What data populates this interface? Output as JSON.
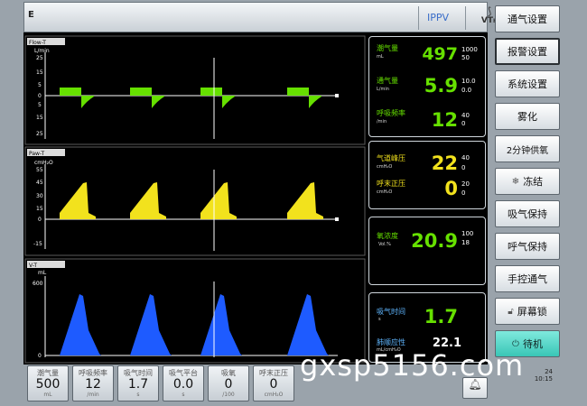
{
  "header": {
    "mode_letter": "E",
    "vent_mode": "IPPV",
    "trigger_label": "VT",
    "trigger_sub": "H"
  },
  "waves": {
    "flow": {
      "title": "Flow-T",
      "unit": "L/min",
      "ticks": [
        "25",
        "15",
        "5",
        "0",
        "5",
        "15",
        "25"
      ]
    },
    "paw": {
      "title": "Paw-T",
      "unit": "cmH₂O",
      "ticks": [
        "55",
        "45",
        "30",
        "15",
        "0",
        "-15"
      ]
    },
    "volume": {
      "title": "V-T",
      "unit": "mL",
      "ticks": [
        "600",
        "0"
      ]
    }
  },
  "values": {
    "tidal": {
      "label": "潮气量",
      "unit": "mL",
      "value": "497",
      "hi": "1000",
      "lo": "50"
    },
    "minute": {
      "label": "通气量",
      "unit": "L/min",
      "value": "5.9",
      "hi": "10.0",
      "lo": "0.0"
    },
    "rate": {
      "label": "呼吸频率",
      "unit": "/min",
      "value": "12",
      "hi": "40",
      "lo": "0"
    },
    "peak": {
      "label": "气道峰压",
      "unit": "cmH₂O",
      "value": "22",
      "hi": "40",
      "lo": "0"
    },
    "peep": {
      "label": "呼末正压",
      "unit": "cmH₂O",
      "value": "0",
      "hi": "20",
      "lo": "0"
    },
    "o2": {
      "label": "氧浓度",
      "unit": "Vol.%",
      "value": "20.9",
      "hi": "100",
      "lo": "18"
    },
    "insp_time": {
      "label": "吸气时间",
      "unit": "s",
      "value": "1.7"
    },
    "compliance": {
      "label": "肺顺应性",
      "unit": "mL/cmH₂O",
      "value": "22.1"
    }
  },
  "menu": {
    "vent_settings": "通气设置",
    "alarm_settings": "报警设置",
    "system_settings": "系统设置",
    "nebulize": "雾化",
    "two_min_oxygen": "2分钟供氧",
    "freeze": "冻结",
    "insp_hold": "吸气保持",
    "exp_hold": "呼气保持",
    "manual_vent": "手控通气",
    "screen_lock": "屏幕锁",
    "standby": "待机"
  },
  "params": [
    {
      "label": "潮气量",
      "value": "500",
      "unit": "mL"
    },
    {
      "label": "呼吸频率",
      "value": "12",
      "unit": "/min"
    },
    {
      "label": "吸气时间",
      "value": "1.7",
      "unit": "s"
    },
    {
      "label": "吸气平台",
      "value": "0.0",
      "unit": "s"
    },
    {
      "label": "吸氧",
      "value": "0",
      "unit": "/100"
    },
    {
      "label": "呼末正压",
      "value": "0",
      "unit": "cmH₂O"
    }
  ],
  "clock": {
    "date": "24",
    "time": "10:15"
  },
  "watermark": "gxsp5156.com",
  "colors": {
    "flow": "#66e000",
    "paw": "#f2e21d",
    "volume": "#1e5bff",
    "standby": "#39c6b6"
  }
}
